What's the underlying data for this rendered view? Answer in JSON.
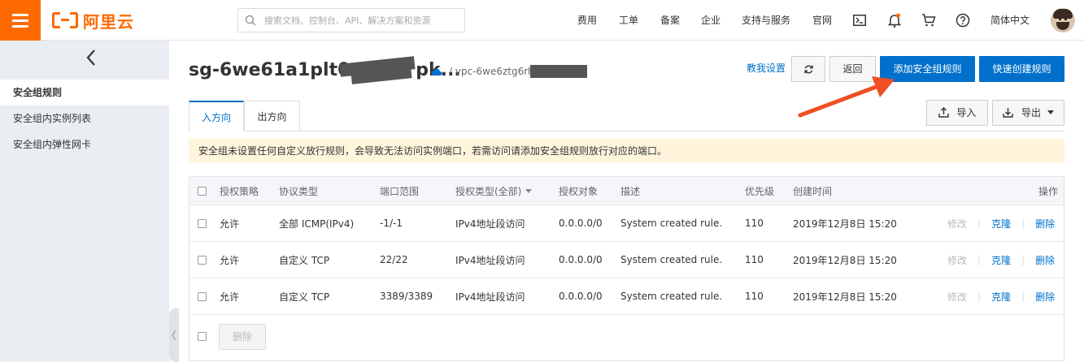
{
  "topbar": {
    "logo_text": "阿里云",
    "search_placeholder": "搜索文档、控制台、API、解决方案和资源",
    "nav": [
      "费用",
      "工单",
      "备案",
      "企业",
      "支持与服务",
      "官网"
    ],
    "lang": "简体中文"
  },
  "sidebar": {
    "items": [
      {
        "label": "安全组规则",
        "active": true
      },
      {
        "label": "安全组内实例列表",
        "active": false
      },
      {
        "label": "安全组内弹性网卡",
        "active": false
      }
    ]
  },
  "header": {
    "title": "sg-6we61a1plt0yt",
    "title_suffix": "pk...",
    "vpc": "/ vpc-6we6ztg6rhg",
    "teach": "教我设置",
    "back": "返回",
    "add_rule": "添加安全组规则",
    "quick_create": "快速创建规则"
  },
  "tabs": [
    {
      "label": "入方向",
      "active": true
    },
    {
      "label": "出方向",
      "active": false
    }
  ],
  "toolbar": {
    "import": "导入",
    "export": "导出"
  },
  "notice": "安全组未设置任何自定义放行规则，会导致无法访问实例端口，若需访问请添加安全组规则放行对应的端口。",
  "table": {
    "columns": [
      "授权策略",
      "协议类型",
      "端口范围",
      "授权类型(全部)",
      "授权对象",
      "描述",
      "优先级",
      "创建时间",
      "操作"
    ],
    "rows": [
      {
        "policy": "允许",
        "protocol": "全部 ICMP(IPv4)",
        "port": "-1/-1",
        "auth_type": "IPv4地址段访问",
        "target": "0.0.0.0/0",
        "desc": "System created rule.",
        "priority": "110",
        "created": "2019年12月8日 15:20",
        "op_edit": "修改",
        "op_clone": "克隆",
        "op_delete": "删除"
      },
      {
        "policy": "允许",
        "protocol": "自定义 TCP",
        "port": "22/22",
        "auth_type": "IPv4地址段访问",
        "target": "0.0.0.0/0",
        "desc": "System created rule.",
        "priority": "110",
        "created": "2019年12月8日 15:20",
        "op_edit": "修改",
        "op_clone": "克隆",
        "op_delete": "删除"
      },
      {
        "policy": "允许",
        "protocol": "自定义 TCP",
        "port": "3389/3389",
        "auth_type": "IPv4地址段访问",
        "target": "0.0.0.0/0",
        "desc": "System created rule.",
        "priority": "110",
        "created": "2019年12月8日 15:20",
        "op_edit": "修改",
        "op_clone": "克隆",
        "op_delete": "删除"
      }
    ],
    "delete_button": "删除"
  },
  "colors": {
    "brand": "#ff6a00",
    "primary": "#0070cc",
    "notice_bg": "#fff5dc",
    "arrow": "#f04e23"
  }
}
